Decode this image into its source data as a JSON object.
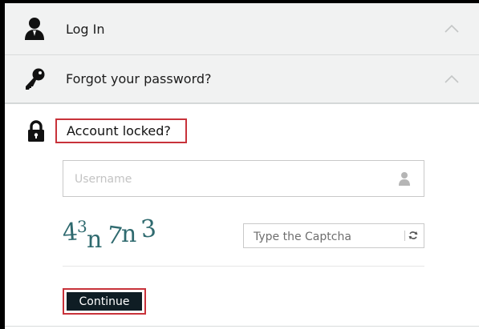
{
  "accordion": {
    "login": {
      "title": "Log In",
      "icon": "user-icon",
      "state": "collapsed"
    },
    "forgot": {
      "title": "Forgot your password?",
      "icon": "key-icon",
      "state": "collapsed"
    },
    "locked": {
      "title": "Account locked?",
      "icon": "lock-icon",
      "state": "expanded"
    }
  },
  "form": {
    "username": {
      "value": "",
      "placeholder": "Username",
      "icon": "user-icon"
    },
    "captcha": {
      "image_text": "43n7n3",
      "input_value": "",
      "input_placeholder": "Type the Captcha",
      "refresh_icon": "refresh-icon"
    },
    "continue_label": "Continue"
  },
  "colors": {
    "header_bg": "#f1f2f2",
    "button_bg": "#0f1d24",
    "highlight": "#c8323a",
    "captcha_text": "#2f6a6f"
  }
}
